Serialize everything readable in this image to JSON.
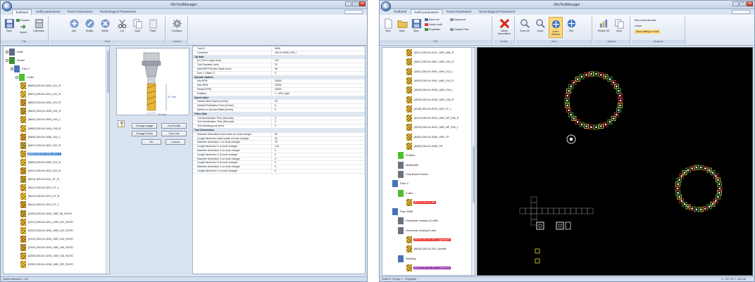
{
  "window1": {
    "title": "WinToolManager",
    "orb": "WS",
    "tabs": [
      "Toolbank",
      "Outfit parameters",
      "Posts Parameters",
      "Technological Parameters"
    ],
    "ribbon": {
      "groups": [
        "File",
        "Tools",
        "Options"
      ],
      "buttons": [
        "Save",
        "Import",
        "Calculator",
        "Add",
        "Modify",
        "Delete",
        "Cut",
        "Copy",
        "Paste",
        "Configure"
      ],
      "small_buttons": [
        "Rename",
        "Export"
      ]
    },
    "tree": {
      "top_nodes": [
        "Drills",
        "Router"
      ],
      "face_node": "Face 1",
      "cutter_node": "Cutter",
      "items": [
        "[5600] 300-04-0002_012_R",
        "[5601] 300-04-0001_012_R",
        "[5602] 300-04-0002_014_R",
        "[5603] 300-04-0003_016_R",
        "[5604] 300-04-0004_016_L",
        "[5605] 300-04-0005_018_R",
        "[5606] 300-04-0006_018_L",
        "[5607] 300-04-0007_020_R",
        "[5608] 300-04-0008_020_L",
        "[5609] 300-04-0009_024_R",
        "[5610] 300-04-0010_025_R",
        "[5611] 300-04-0011_0T_R",
        "[5612] 300-04-0012_0T_L",
        "[5613] 300-04-0013_0T_R",
        "[5614] 300-04-0014_0T_L",
        "[2200] 300-04-0200_VAR_08_RLRO",
        "[2201] 300-04-0201_VAR_010_RLRO",
        "[2202] 300-04-0202_VAR_012_RLRO",
        "[2203] 300-04-0203_VAR_014_RLRO",
        "[2204] 300-04-0204_VAR_016_RLRO",
        "[2205] 300-04-0205_VAR_018_RLRO",
        "[2206] 300-04-0206_VAR_020_RLRO"
      ],
      "selected_index": 8
    },
    "preview": {
      "dim_len": "57 mm",
      "dim_dia": "20 mm"
    },
    "dialog_buttons": {
      "change_image": "Change image",
      "tool_profile": "Tool Profile",
      "change_photo": "Change Photo",
      "tool_link": "Tool Link",
      "ok": "OK",
      "cancel": "Cancel"
    },
    "grid": [
      {
        "type": "row",
        "k": "Tool ID",
        "v": "5608"
      },
      {
        "type": "row",
        "k": "Comment",
        "v": "300-04-0008_020_L"
      },
      {
        "type": "cat",
        "k": "Tip data"
      },
      {
        "type": "row",
        "k": "[LT] Tool Length (mm)",
        "v": "140"
      },
      {
        "type": "row",
        "k": "Tool Diameter (mm)",
        "v": "20"
      },
      {
        "type": "row",
        "k": "[MAXDEPTH] Max Depth (mm)",
        "v": "48"
      },
      {
        "type": "row",
        "k": "Axis C Offset (°)",
        "v": "0"
      },
      {
        "type": "cat",
        "k": "Spindle rotation"
      },
      {
        "type": "row",
        "k": "Min RPM",
        "v": "16000"
      },
      {
        "type": "row",
        "k": "Max RPM",
        "v": "24000"
      },
      {
        "type": "row",
        "k": "Default RPM",
        "v": "18000"
      },
      {
        "type": "row",
        "k": "Rotation",
        "v": "1 - M03_right"
      },
      {
        "type": "cat",
        "k": "Speed value"
      },
      {
        "type": "row",
        "k": "Default Work Speed (m/min)",
        "v": "18"
      },
      {
        "type": "row",
        "k": "Default Penetration Feed (m/min)",
        "v": "6"
      },
      {
        "type": "row",
        "k": "Speed on incomed fillets (m/min)",
        "v": "0"
      },
      {
        "type": "cat",
        "k": "Other data"
      },
      {
        "type": "row",
        "k": "Tool Acceleration Time (Seconds)",
        "v": "3"
      },
      {
        "type": "row",
        "k": "Tool Deceleration Time (Seconds)",
        "v": "4"
      },
      {
        "type": "row",
        "k": "Tool cleaning puck (mm)",
        "v": "0"
      },
      {
        "type": "cat",
        "k": "Tool Dimensions"
      },
      {
        "type": "row",
        "k": "Diameter dimension tools holder on tools changer",
        "v": "63"
      },
      {
        "type": "row",
        "k": "Length dimension tools holder on tools changer",
        "v": "90"
      },
      {
        "type": "row",
        "k": "Diameter dimension 1 on tools changer",
        "v": "75"
      },
      {
        "type": "row",
        "k": "Length dimension 1 on tools changer",
        "v": "140"
      },
      {
        "type": "row",
        "k": "Diameter dimension 2 on tools changer",
        "v": "0"
      },
      {
        "type": "row",
        "k": "Length dimension 2 on tools changer",
        "v": "0"
      },
      {
        "type": "row",
        "k": "Diameter dimension 3 on tools changer",
        "v": "0"
      },
      {
        "type": "row",
        "k": "Length dimension 3 on tools changer",
        "v": "0"
      },
      {
        "type": "row",
        "k": "Diameter dimension 4 on tools changer",
        "v": "0"
      },
      {
        "type": "row",
        "k": "Length dimension 4 on tools changer",
        "v": "0"
      }
    ],
    "status": "Outfit selected > 1/5"
  },
  "window2": {
    "title": "WinToolManager",
    "orb": "WS",
    "tabs": [
      "Toolbank",
      "Outfit parameters",
      "Posts Parameters",
      "Technological Parameters"
    ],
    "ribbon": {
      "groups": [
        "File",
        "Modify",
        "View",
        "Options",
        "Viewport"
      ],
      "buttons": [
        "New",
        "Open",
        "Save",
        "Delete Association",
        "Zoom All",
        "Zoom",
        "Zoom Window",
        "Pan",
        "Enable 3D",
        "Cpyo"
      ],
      "small_buttons": [
        "Save xml",
        "Delete outfit",
        "Properties",
        "Data proof",
        "Graphic Print"
      ],
      "options": [
        "Sets horizontal face",
        "Colors",
        "Save settings on exit"
      ]
    },
    "tree": {
      "items": [
        "[5247] 300-04-0247_VAR_008_R",
        "[4067] 300-04-0067_VAR_010_R",
        "[4091] 300-04-0091_VAR_012_L",
        "[4092] 300-04-0002_VAR_014_R",
        "[4093] 300-04-0003_VAR_016_L",
        "[4095] 300-04-0005_VAR_018_R",
        "[4116] 300-04-0016_VAR_0T_L",
        "[4312] 300-04-0012_VAR_NP_018_R",
        "[4313] 300-04-0013_VAR_NP_018_L",
        "[6400] 300-04-0400_VAR_TP",
        "[5405] 300-04-0405_TR",
        "Profiled",
        "Multiprofile",
        "Chip Board Device",
        "Face 3",
        "Cutter",
        "[5300] 300-04-8R",
        "Face 3456",
        "Horizontal rotating 1/2 drills",
        "Horizontal rotating & mills",
        "[5025] 300-04-016_Aggregate",
        "[5026] 300-04-016_Spindle",
        "Sanding",
        "[5666] 300-04-003 Subfinisher"
      ]
    },
    "status_left": "Outfit 3, Group 1 - Originale -",
    "status_right": "X: 737.76 Y: 263.58"
  }
}
